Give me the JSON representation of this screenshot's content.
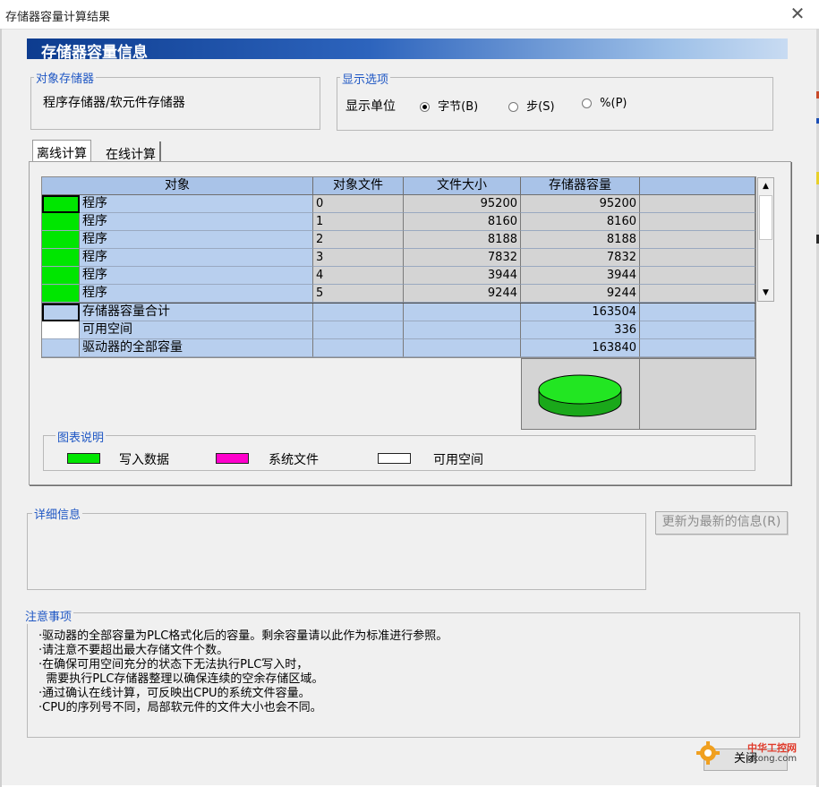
{
  "window": {
    "title": "存储器容量计算结果"
  },
  "header": {
    "title": "存储器容量信息"
  },
  "target": {
    "label": "对象存储器",
    "value": "程序存储器/软元件存储器"
  },
  "display": {
    "label": "显示选项",
    "unit_label": "显示单位",
    "options": [
      {
        "label": "字节(B)",
        "selected": true
      },
      {
        "label": "步(S)",
        "selected": false
      },
      {
        "label": "%(P)",
        "selected": false
      }
    ]
  },
  "tabs": [
    {
      "label": "离线计算",
      "active": true
    },
    {
      "label": "在线计算",
      "active": false
    }
  ],
  "table": {
    "columns": [
      "对象",
      "对象文件",
      "文件大小",
      "存储器容量",
      ""
    ],
    "rows": [
      {
        "name": "程序",
        "file": "0",
        "size": "95200",
        "capacity": "95200",
        "color": "#00e600"
      },
      {
        "name": "程序",
        "file": "1",
        "size": "8160",
        "capacity": "8160",
        "color": "#00e600"
      },
      {
        "name": "程序",
        "file": "2",
        "size": "8188",
        "capacity": "8188",
        "color": "#00e600"
      },
      {
        "name": "程序",
        "file": "3",
        "size": "7832",
        "capacity": "7832",
        "color": "#00e600"
      },
      {
        "name": "程序",
        "file": "4",
        "size": "3944",
        "capacity": "3944",
        "color": "#00e600"
      },
      {
        "name": "程序",
        "file": "5",
        "size": "9244",
        "capacity": "9244",
        "color": "#00e600"
      }
    ],
    "summary": [
      {
        "name": "存储器容量合计",
        "value": "163504",
        "color": "#b8cfee"
      },
      {
        "name": "可用空间",
        "value": "336",
        "color": "#ffffff"
      },
      {
        "name": "驱动器的全部容量",
        "value": "163840",
        "color": "#b8cfee"
      }
    ]
  },
  "legend": {
    "label": "图表说明",
    "items": [
      {
        "label": "写入数据",
        "color": "#00e600"
      },
      {
        "label": "系统文件",
        "color": "#ff00cc"
      },
      {
        "label": "可用空间",
        "color": "#ffffff"
      }
    ]
  },
  "details": {
    "label": "详细信息",
    "refresh_button": "更新为最新的信息(R)"
  },
  "notes": {
    "label": "注意事项",
    "lines": [
      "·驱动器的全部容量为PLC格式化后的容量。剩余容量请以此作为标准进行参照。",
      "·请注意不要超出最大存储文件个数。",
      "·在确保可用空间充分的状态下无法执行PLC写入时，",
      "  需要执行PLC存储器整理以确保连续的空余存储区域。",
      "·通过确认在线计算，可反映出CPU的系统文件容量。",
      "·CPU的序列号不同，局部软元件的文件大小也会不同。"
    ]
  },
  "footer": {
    "close_button": "关闭",
    "watermark": "中华工控网",
    "watermark_url": "gkong.com"
  },
  "colors": {
    "accent": "#1f57c4",
    "written": "#00e600"
  }
}
